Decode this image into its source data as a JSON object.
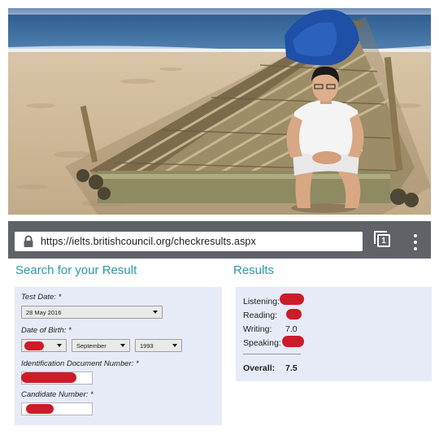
{
  "browser": {
    "url": "https://ielts.britishcouncil.org/checkresults.aspx",
    "tab_count": "1"
  },
  "search": {
    "title": "Search for your Result",
    "test_date_label": "Test Date: *",
    "test_date_value": "28 May 2016",
    "dob_label": "Date of Birth: *",
    "dob_month": "September",
    "dob_year": "1993",
    "id_doc_label": "Identification Document Number: *",
    "candidate_label": "Candidate Number: *"
  },
  "results": {
    "title": "Results",
    "listening_label": "Listening:",
    "reading_label": "Reading:",
    "writing_label": "Writing:",
    "writing_value": "7.0",
    "speaking_label": "Speaking:",
    "overall_label": "Overall:",
    "overall_value": "7.5"
  },
  "colors": {
    "accent": "#2a97a4",
    "panel": "#e6ebf7",
    "redaction": "#cc1c2a",
    "toolbar": "#5f6368"
  },
  "icons": [
    "lock-icon",
    "tab-switcher-icon",
    "overflow-menu-icon",
    "dropdown-arrow-icon"
  ]
}
